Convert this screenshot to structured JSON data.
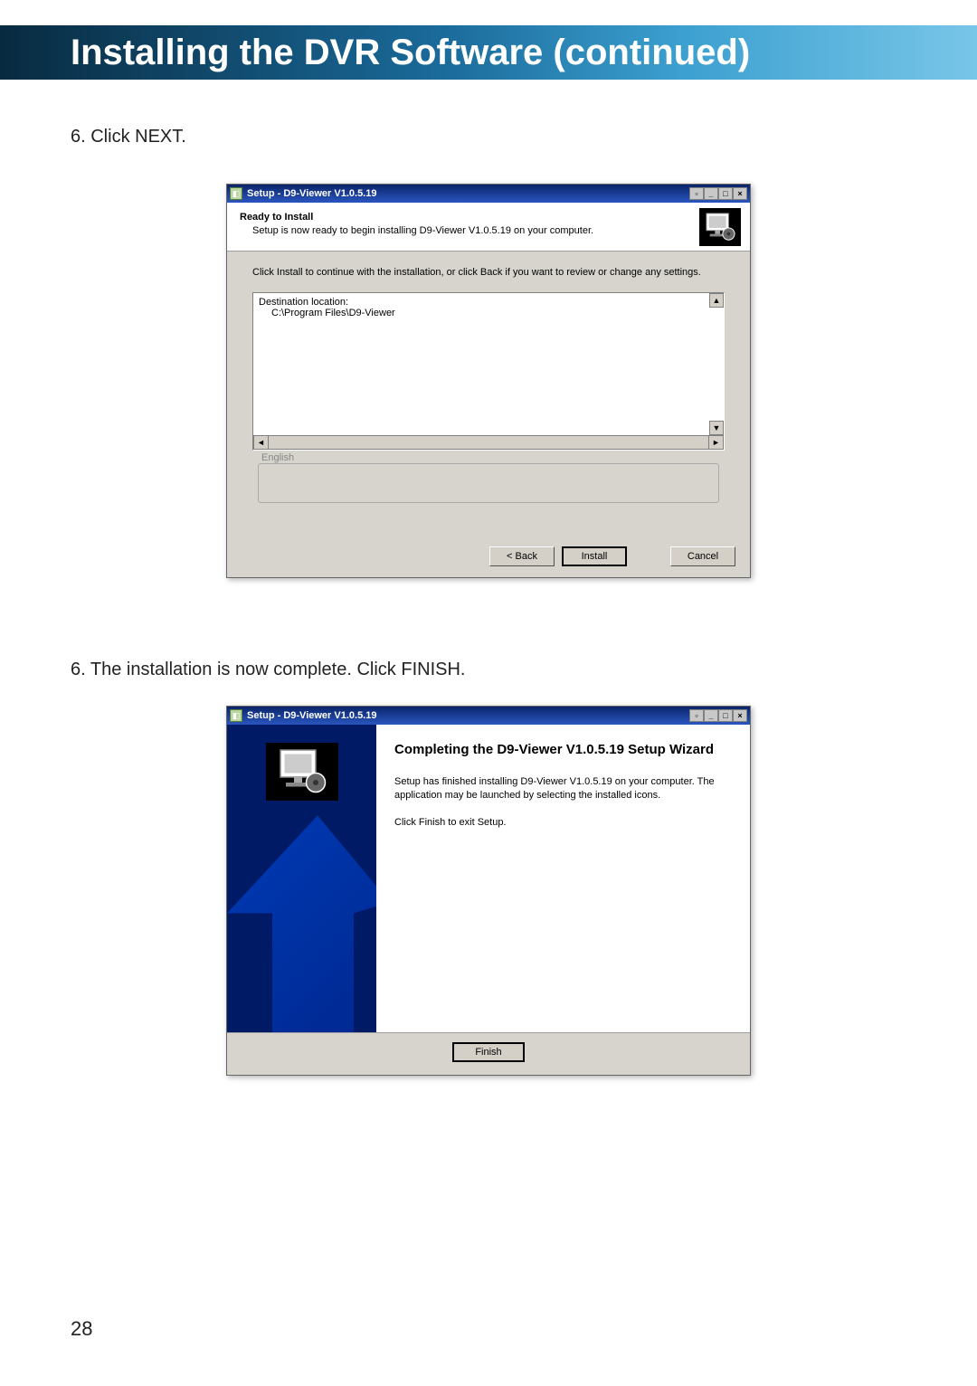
{
  "banner": {
    "title": "Installing the DVR Software (continued)"
  },
  "step1": {
    "text": "6. Click NEXT."
  },
  "installer1": {
    "title": "Setup - D9-Viewer V1.0.5.19",
    "header_title": "Ready to Install",
    "header_sub": "Setup is now ready to begin installing D9-Viewer V1.0.5.19 on your computer.",
    "instruct": "Click Install to continue with the installation, or click Back if you want to review or change any settings.",
    "dest_label": "Destination location:",
    "dest_path": "C:\\Program Files\\D9-Viewer",
    "lang": "English",
    "back_btn": "< Back",
    "install_btn": "Install",
    "cancel_btn": "Cancel"
  },
  "step2": {
    "text": "6. The installation is now complete. Click FINISH."
  },
  "installer2": {
    "title": "Setup - D9-Viewer V1.0.5.19",
    "finish_title": "Completing the D9-Viewer V1.0.5.19 Setup Wizard",
    "finish_p1": "Setup has finished installing D9-Viewer V1.0.5.19 on your computer. The application may be launched by selecting the installed icons.",
    "finish_p2": "Click Finish to exit Setup.",
    "finish_btn": "Finish"
  },
  "page_number": "28"
}
